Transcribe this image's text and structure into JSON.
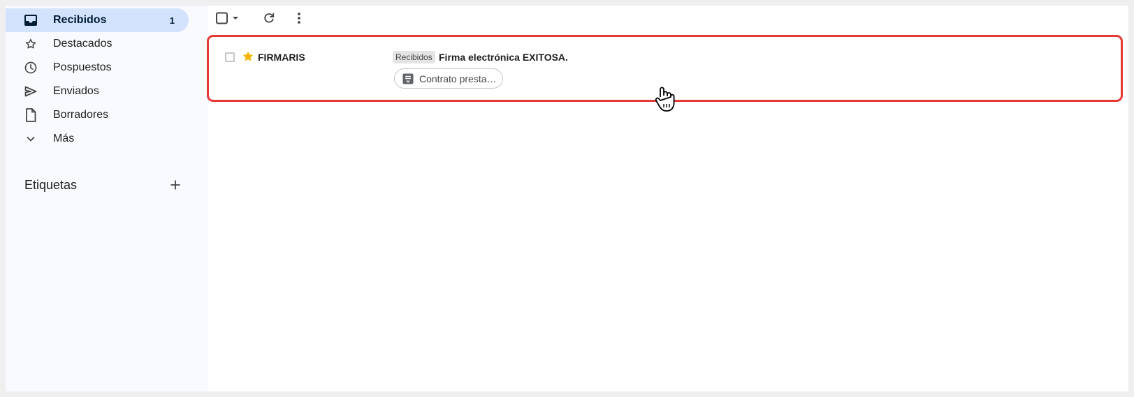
{
  "sidebar": {
    "items": [
      {
        "label": "Recibidos",
        "icon": "inbox-icon",
        "count": "1",
        "active": true
      },
      {
        "label": "Destacados",
        "icon": "star-icon"
      },
      {
        "label": "Pospuestos",
        "icon": "clock-icon"
      },
      {
        "label": "Enviados",
        "icon": "send-icon"
      },
      {
        "label": "Borradores",
        "icon": "draft-icon"
      },
      {
        "label": "Más",
        "icon": "chevron-down-icon"
      }
    ],
    "labels_title": "Etiquetas"
  },
  "email": {
    "sender": "FIRMARIS",
    "label_chip": "Recibidos",
    "subject": "Firma electrónica EXITOSA.",
    "attachment": "Contrato presta…",
    "starred": true
  },
  "colors": {
    "active_nav_bg": "#d3e3fd",
    "highlight_border": "#e53935",
    "star": "#f4b400"
  }
}
